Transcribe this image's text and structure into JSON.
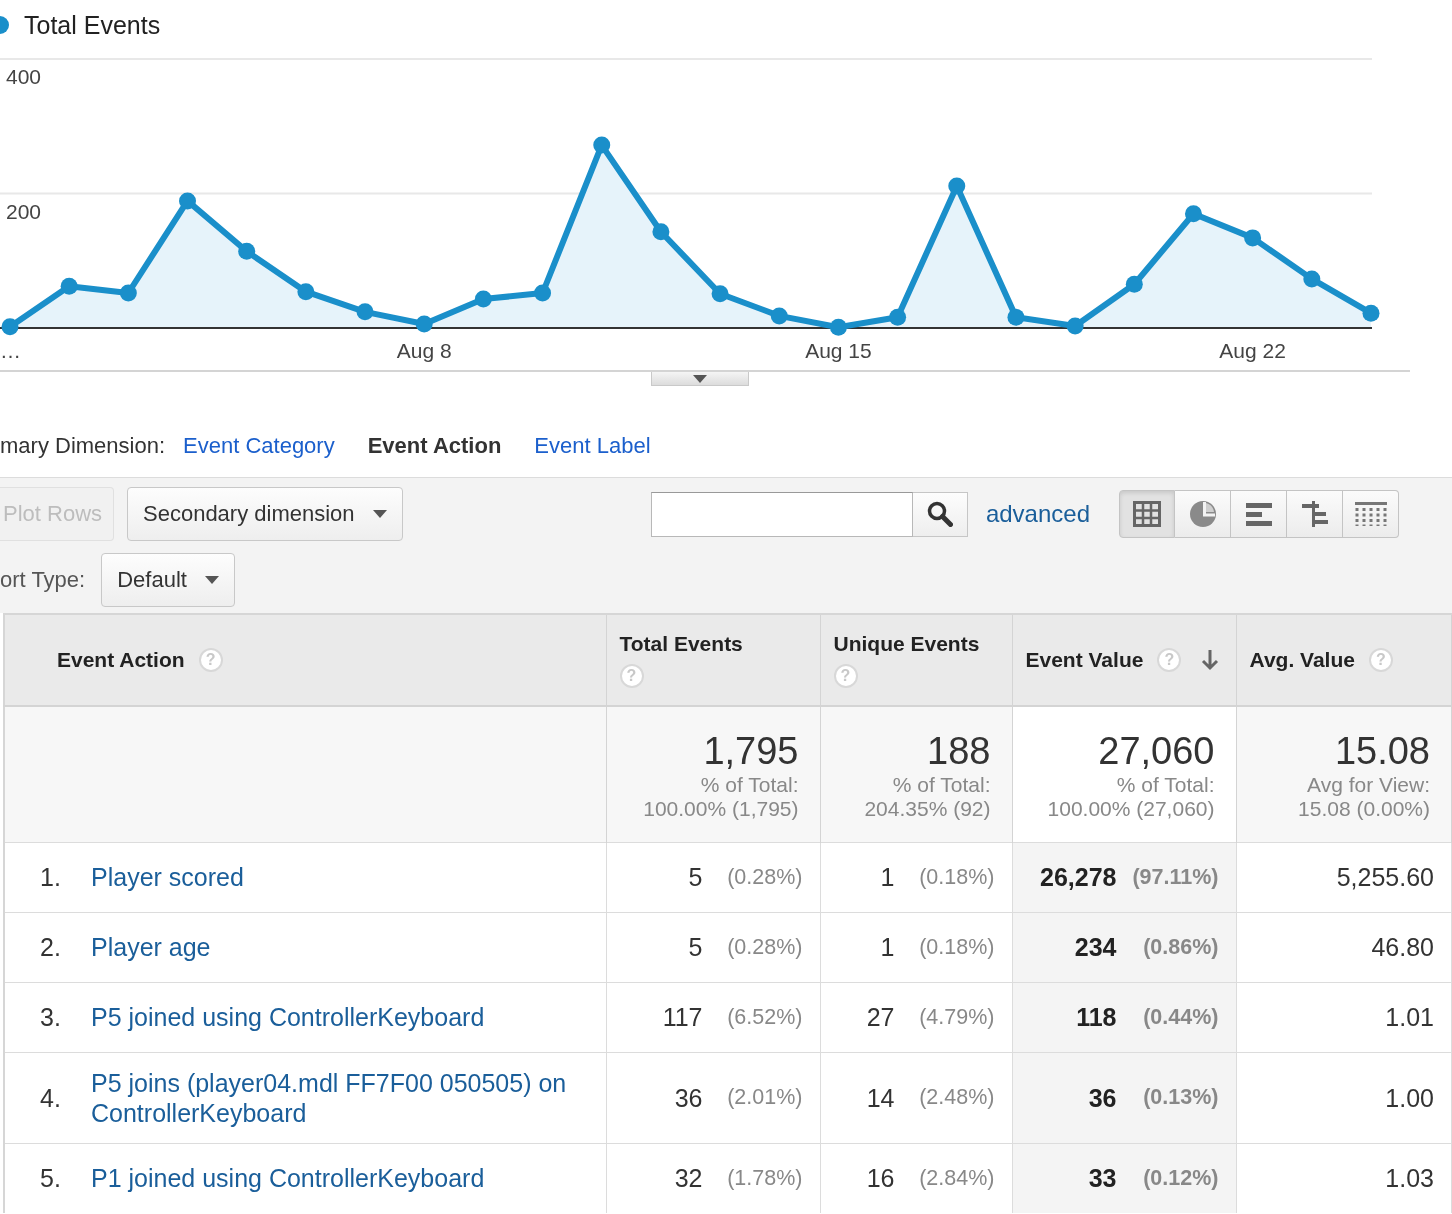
{
  "chart": {
    "chart_data": {
      "type": "area",
      "categories": [
        "…",
        null,
        null,
        null,
        null,
        null,
        null,
        "Aug 8",
        null,
        null,
        null,
        null,
        null,
        null,
        "Aug 15",
        null,
        null,
        null,
        null,
        null,
        null,
        "Aug 22",
        null,
        null
      ],
      "series": [
        {
          "name": "Total Events",
          "color": "#1a8fca",
          "values": [
            2,
            62,
            52,
            189,
            114,
            54,
            24,
            6,
            43,
            52,
            272,
            143,
            51,
            18,
            1,
            16,
            211,
            16,
            3,
            65,
            170,
            134,
            73,
            22
          ]
        }
      ],
      "yticks": [
        200,
        400
      ],
      "ylim": [
        0,
        400
      ]
    }
  },
  "primary_dimension": {
    "label": "mary Dimension:",
    "options": [
      {
        "label": "Event Category",
        "selected": false
      },
      {
        "label": "Event Action",
        "selected": true
      },
      {
        "label": "Event Label",
        "selected": false
      }
    ]
  },
  "toolbar": {
    "plot_rows": {
      "label": "Plot Rows",
      "disabled": true
    },
    "secondary_dimension": {
      "label": "Secondary dimension"
    },
    "advanced_link": "advanced",
    "views": [
      {
        "kind": "table",
        "selected": true
      },
      {
        "kind": "pie",
        "selected": false
      },
      {
        "kind": "bar",
        "selected": false
      },
      {
        "kind": "comparison",
        "selected": false
      },
      {
        "kind": "pivot",
        "selected": false
      }
    ],
    "sort_type": {
      "label": "ort Type:",
      "value": "Default"
    }
  },
  "table": {
    "columns": [
      {
        "label": "Event Action",
        "help": "?",
        "sorted": false
      },
      {
        "label": "Total Events",
        "help": "?",
        "sorted": false
      },
      {
        "label": "Unique Events",
        "help": "?",
        "sorted": false
      },
      {
        "label": "Event Value",
        "help": "?",
        "sorted": true
      },
      {
        "label": "Avg. Value",
        "help": "?",
        "sorted": false
      }
    ],
    "totals": [
      {
        "value": "1,795",
        "label": "% of Total:",
        "detail": "100.00% (1,795)"
      },
      {
        "value": "188",
        "label": "% of Total:",
        "detail": "204.35% (92)"
      },
      {
        "value": "27,060",
        "label": "% of Total:",
        "detail": "100.00% (27,060)"
      },
      {
        "value": "15.08",
        "label": "Avg for View:",
        "detail": "15.08 (0.00%)"
      }
    ],
    "rows": [
      {
        "cells": [
          {
            "index": "1.",
            "label": "Player scored"
          },
          {
            "value": "5",
            "percent": "(0.28%)"
          },
          {
            "value": "1",
            "percent": "(0.18%)"
          },
          {
            "value": "26,278",
            "percent": "(97.11%)"
          },
          {
            "value": "5,255.60"
          }
        ]
      },
      {
        "cells": [
          {
            "index": "2.",
            "label": "Player age"
          },
          {
            "value": "5",
            "percent": "(0.28%)"
          },
          {
            "value": "1",
            "percent": "(0.18%)"
          },
          {
            "value": "234",
            "percent": "(0.86%)"
          },
          {
            "value": "46.80"
          }
        ]
      },
      {
        "cells": [
          {
            "index": "3.",
            "label": "P5 joined using ControllerKeyboard"
          },
          {
            "value": "117",
            "percent": "(6.52%)"
          },
          {
            "value": "27",
            "percent": "(4.79%)"
          },
          {
            "value": "118",
            "percent": "(0.44%)"
          },
          {
            "value": "1.01"
          }
        ]
      },
      {
        "cells": [
          {
            "index": "4.",
            "label": "P5 joins (player04.mdl FF7F00 050505) on ControllerKeyboard"
          },
          {
            "value": "36",
            "percent": "(2.01%)"
          },
          {
            "value": "14",
            "percent": "(2.48%)"
          },
          {
            "value": "36",
            "percent": "(0.13%)"
          },
          {
            "value": "1.00"
          }
        ]
      },
      {
        "cells": [
          {
            "index": "5.",
            "label": "P1 joined using ControllerKeyboard"
          },
          {
            "value": "32",
            "percent": "(1.78%)"
          },
          {
            "value": "16",
            "percent": "(2.84%)"
          },
          {
            "value": "33",
            "percent": "(0.12%)"
          },
          {
            "value": "1.03"
          }
        ]
      }
    ]
  }
}
